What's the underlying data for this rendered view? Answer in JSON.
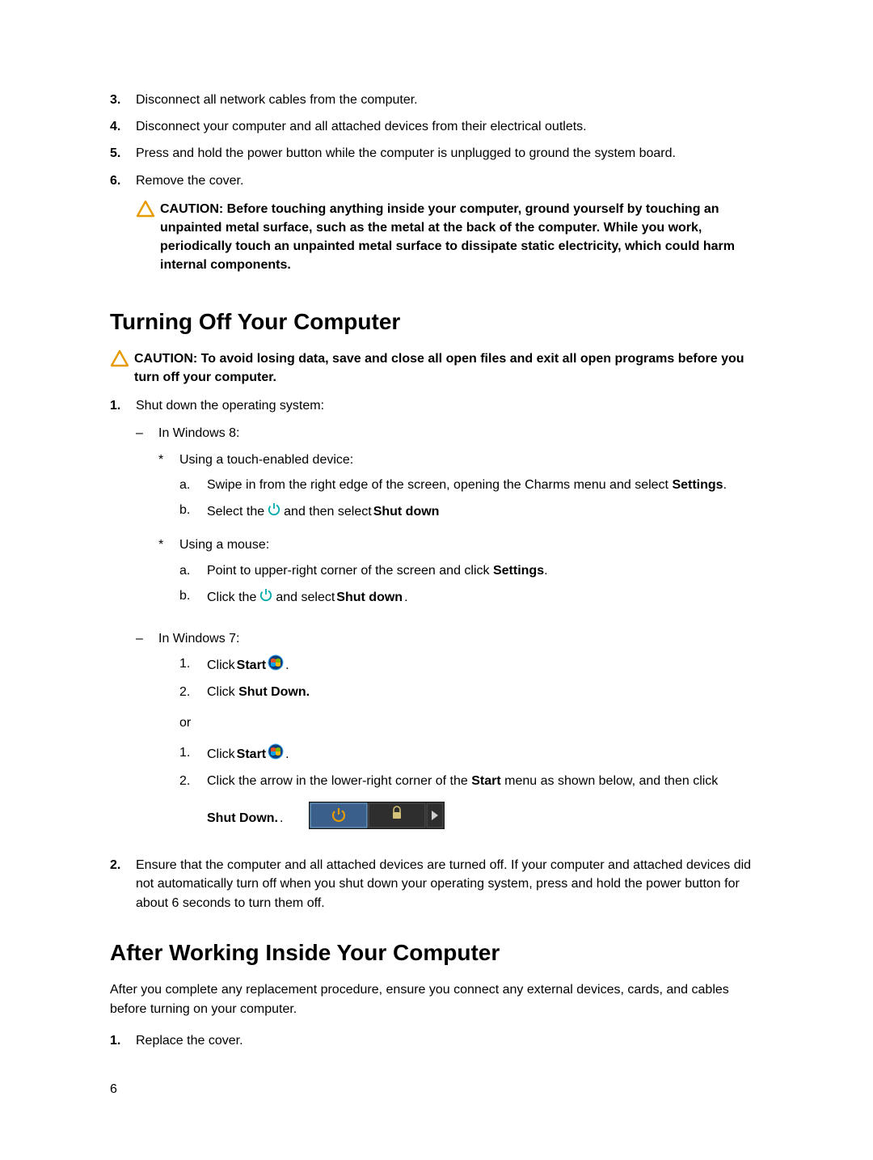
{
  "page_number": "6",
  "steps_top": {
    "s3": {
      "n": "3.",
      "t": "Disconnect all network cables from the computer."
    },
    "s4": {
      "n": "4.",
      "t": "Disconnect your computer and all attached devices from their electrical outlets."
    },
    "s5": {
      "n": "5.",
      "t": "Press and hold the power button while the computer is unplugged to ground the system board."
    },
    "s6": {
      "n": "6.",
      "t": "Remove the cover."
    }
  },
  "caution1": {
    "label": "CAUTION: ",
    "text": "Before touching anything inside your computer, ground yourself by touching an unpainted metal surface, such as the metal at the back of the computer. While you work, periodically touch an unpainted metal surface to dissipate static electricity, which could harm internal components."
  },
  "section_turnoff": "Turning Off Your Computer",
  "caution2": {
    "label": "CAUTION: ",
    "text": "To avoid losing data, save and close all open files and exit all open programs before you turn off your computer."
  },
  "turnoff_steps": {
    "s1": {
      "n": "1.",
      "t": "Shut down the operating system:"
    },
    "s2": {
      "n": "2.",
      "t": "Ensure that the computer and all attached devices are turned off. If your computer and attached devices did not automatically turn off when you shut down your operating system, press and hold the power button for about 6 seconds to turn them off."
    }
  },
  "os": {
    "win8": "In Windows 8:",
    "win7": "In Windows 7:"
  },
  "touch_label": "Using a touch-enabled device:",
  "mouse_label": "Using a mouse:",
  "touch_a_pre": "Swipe in from the right edge of the screen, opening the Charms menu and select ",
  "settings_word": "Settings",
  "touch_b_pre": "Select the ",
  "touch_b_post": " and then select ",
  "shut_down_word": "Shut down",
  "mouse_a_pre": "Point to upper-right corner of the screen and click ",
  "mouse_b_pre": "Click the ",
  "mouse_b_post": " and select ",
  "win7_click": "Click ",
  "start_word": "Start",
  "win7_s2": "Click ",
  "shut_down_period": "Shut Down.",
  "or_word": "or",
  "win7_alt2_pre": "Click the arrow in the lower-right corner of the ",
  "win7_alt2_post": " menu as shown below, and then click ",
  "shut_down_dotdot": "Shut Down.",
  "section_after": "After Working Inside Your Computer",
  "after_intro": "After you complete any replacement procedure, ensure you connect any external devices, cards, and cables before turning on your computer.",
  "after_s1": {
    "n": "1.",
    "t": "Replace the cover."
  },
  "markers": {
    "a": "a.",
    "b": "b.",
    "n1": "1.",
    "n2": "2.",
    "dash": "–",
    "star": "*"
  }
}
